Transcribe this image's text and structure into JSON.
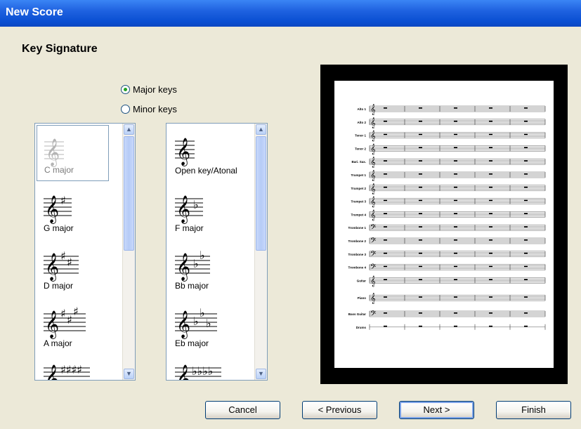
{
  "window": {
    "title": "New Score"
  },
  "page": {
    "heading": "Key Signature"
  },
  "mode": {
    "options": [
      {
        "label": "Major keys",
        "selected": true
      },
      {
        "label": "Minor keys",
        "selected": false
      }
    ]
  },
  "lists": {
    "sharp": {
      "items": [
        {
          "label": "C major",
          "selected": true
        },
        {
          "label": "G major"
        },
        {
          "label": "D major"
        },
        {
          "label": "A major"
        }
      ]
    },
    "flat": {
      "items": [
        {
          "label": "Open key/Atonal"
        },
        {
          "label": "F major"
        },
        {
          "label": "Bb major"
        },
        {
          "label": "Eb major"
        }
      ]
    }
  },
  "preview": {
    "instruments": [
      "Alto 1",
      "Alto 2",
      "Tenor 1",
      "Tenor 2",
      "Bari. Sax.",
      "Trumpet 1",
      "Trumpet 2",
      "Trumpet 3",
      "Trumpet 4",
      "Trombone 1",
      "Trombone 2",
      "Trombone 3",
      "Trombone 4",
      "Guitar",
      "Piano",
      "Bass Guitar",
      "Drums"
    ]
  },
  "buttons": {
    "cancel": "Cancel",
    "previous": "< Previous",
    "next": "Next >",
    "finish": "Finish"
  }
}
